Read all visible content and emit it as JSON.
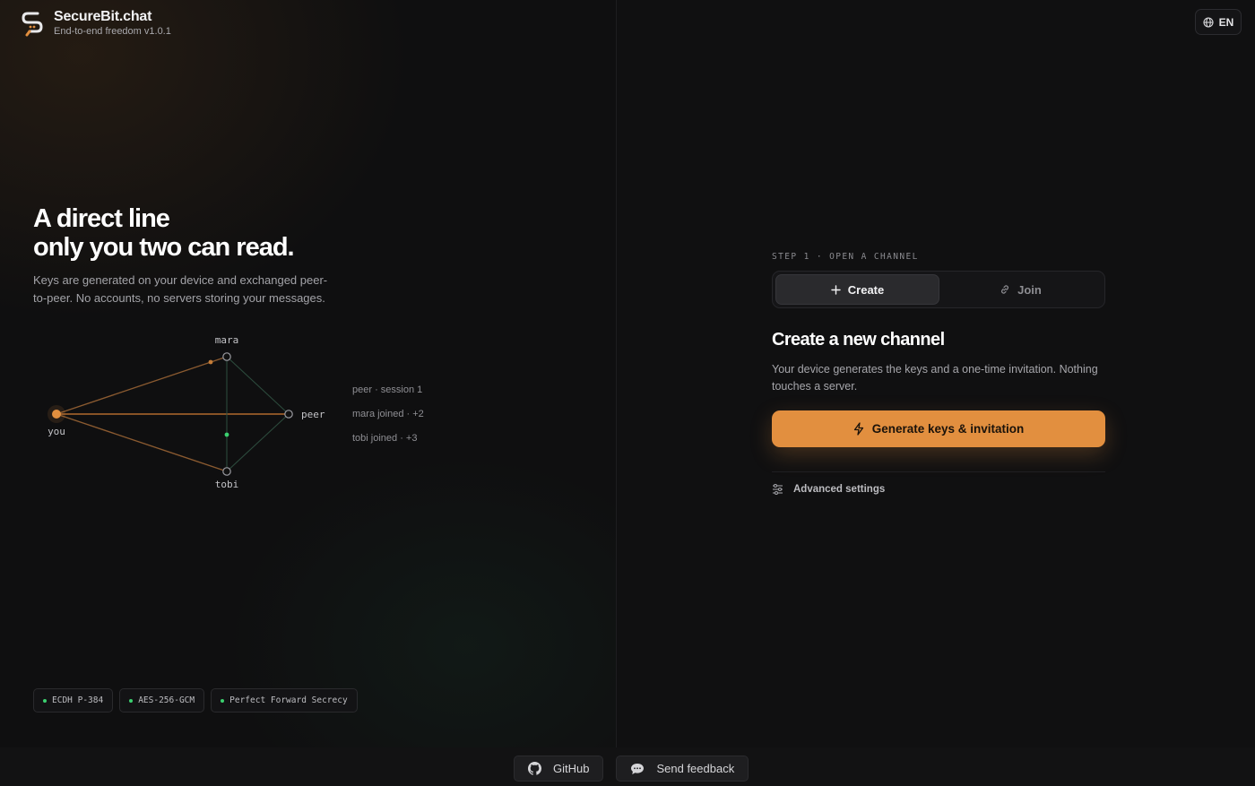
{
  "app": {
    "name": "SecureBit.chat",
    "tagline": "End-to-end freedom v1.0.1"
  },
  "header": {
    "language": "EN"
  },
  "hero": {
    "title_line1": "A direct line",
    "title_line2": "only you two can read.",
    "subtitle": "Keys are generated on your device and exchanged peer-to-peer. No accounts, no servers storing your messages."
  },
  "network": {
    "nodes": {
      "you": "you",
      "mara": "mara",
      "peer": "peer",
      "tobi": "tobi"
    },
    "log": [
      "peer · session 1",
      "mara joined · +2",
      "tobi joined · +3"
    ]
  },
  "badges": [
    "ECDH P-384",
    "AES-256-GCM",
    "Perfect Forward Secrecy"
  ],
  "panel": {
    "step": "STEP 1 · OPEN A CHANNEL",
    "tabs": {
      "create": "Create",
      "join": "Join"
    },
    "active_tab": "Create",
    "title": "Create a new channel",
    "subtitle": "Your device generates the keys and a one-time invitation. Nothing touches a server.",
    "primary_button": "Generate keys & invitation",
    "advanced": "Advanced settings"
  },
  "footer": {
    "github": "GitHub",
    "feedback": "Send feedback"
  },
  "colors": {
    "accent": "#e28f3f",
    "success": "#3bd16f",
    "background": "#0e0e0f"
  },
  "icons": [
    "logo-icon",
    "globe-icon",
    "plus-icon",
    "link-icon",
    "bolt-icon",
    "sliders-icon",
    "github-icon",
    "chat-icon"
  ]
}
